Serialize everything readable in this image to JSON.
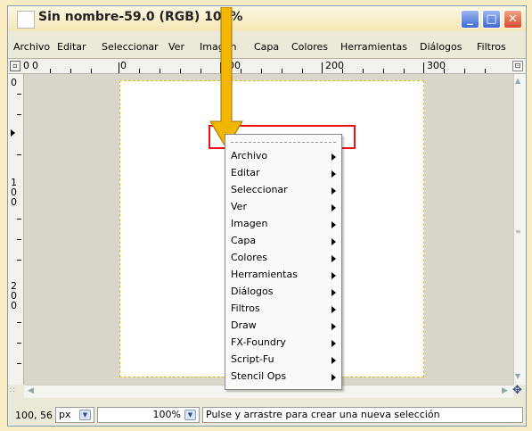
{
  "window": {
    "title": "Sin nombre-59.0 (RGB) 100%",
    "controls": {
      "minimize": "_",
      "maximize": "□",
      "close": "✕"
    }
  },
  "menubar": [
    "Archivo",
    "Editar",
    "Seleccionar",
    "Ver",
    "Imagen",
    "Capa",
    "Colores",
    "Herramientas",
    "Diálogos",
    "Filtros"
  ],
  "ruler": {
    "top_labels": [
      "0",
      "0",
      "100",
      "200",
      "300"
    ],
    "left_labels": [
      "0",
      "1",
      "0",
      "0",
      "2",
      "0",
      "0"
    ]
  },
  "context_menu": {
    "items": [
      "Archivo",
      "Editar",
      "Seleccionar",
      "Ver",
      "Imagen",
      "Capa",
      "Colores",
      "Herramientas",
      "Diálogos",
      "Filtros",
      "Draw",
      "FX-Foundry",
      "Script-Fu",
      "Stencil Ops"
    ]
  },
  "statusbar": {
    "coords": "100, 56",
    "unit": "px",
    "zoom": "100%",
    "message": "Pulse y arrastre para crear una nueva selección"
  },
  "annotation_colors": {
    "highlight_box": "#e11111",
    "arrow": "#f2b705",
    "background": "#fbeec4"
  }
}
